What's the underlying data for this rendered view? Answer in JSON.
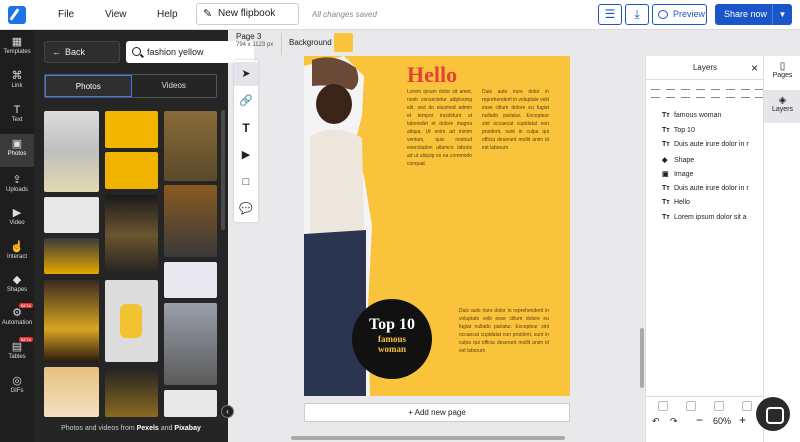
{
  "topbar": {
    "file": "File",
    "view": "View",
    "help": "Help",
    "new_flipbook": "New flipbook",
    "saved": "All changes saved",
    "preview": "Preview",
    "share": "Share now"
  },
  "left_nav": [
    {
      "label": "Templates",
      "icon": "templates-icon"
    },
    {
      "label": "Link",
      "icon": "link-icon"
    },
    {
      "label": "Text",
      "icon": "text-icon"
    },
    {
      "label": "Photos",
      "icon": "photos-icon"
    },
    {
      "label": "Uploads",
      "icon": "uploads-icon"
    },
    {
      "label": "Video",
      "icon": "video-icon"
    },
    {
      "label": "Interact",
      "icon": "interact-icon"
    },
    {
      "label": "Shapes",
      "icon": "shapes-icon"
    },
    {
      "label": "Automation",
      "icon": "automation-icon",
      "badge": "BETA"
    },
    {
      "label": "Tables",
      "icon": "tables-icon",
      "badge": "BETA"
    },
    {
      "label": "GIFs",
      "icon": "gifs-icon"
    }
  ],
  "side_panel": {
    "back": "Back",
    "search_value": "fashion yellow",
    "tab_photos": "Photos",
    "tab_videos": "Videos",
    "credit_prefix": "Photos and videos from",
    "credit_pexels": "Pexels",
    "credit_and": "and",
    "credit_pixabay": "Pixabay"
  },
  "canvas": {
    "page_label": "Page 3",
    "page_dims": "794 x 1123 px",
    "background_label": "Background",
    "background_color": "#f9c33c",
    "add_page": "+ Add new page"
  },
  "flipbook_page": {
    "title": "Hello",
    "col1": "Lorem ipsum dolor sit amet, nostr consectetur adipiscing elit, sed do eiusmod admin et tempor incididunt ut laboredet et dolore magna aliqua. Ut enim ad minim veniam, quis nostrud exercitation ullamco laboris ad ut aliquip ex ea commodo conquat.",
    "col2": "Duis aute irure dolor in reprehenderit in voluptate velit esse cillum dolore eu fugiat nullado pariatur. Excepteur sint occaecat cupidatat non proident, sunt in culpa qui officia deserunt mollit anim id est laborum",
    "col3": "Duis aute irure dolor in reprehenderit in voluptate velit esse cillum dolore eu fugiat nullado pariatur. Excepteur sint occaecat cupidatat non proident, sunt in culpa qui officia deserunt mollit anim id est laborum",
    "badge_line1": "Top 10",
    "badge_line2": "famous",
    "badge_line3": "woman"
  },
  "layers": {
    "title": "Layers",
    "items": [
      {
        "label": "famous woman",
        "type": "text"
      },
      {
        "label": "Top 10",
        "type": "text"
      },
      {
        "label": "Duis aute irure dolor in r",
        "type": "text"
      },
      {
        "label": "Shape",
        "type": "shape"
      },
      {
        "label": "Image",
        "type": "image"
      },
      {
        "label": "Duis aute irure dolor in r",
        "type": "text"
      },
      {
        "label": "Hello",
        "type": "text"
      },
      {
        "label": "Lorem ipsum dolor sit a",
        "type": "text"
      }
    ],
    "zoom": "60%"
  },
  "right_tabs": {
    "pages": "Pages",
    "layers": "Layers"
  },
  "colors": {
    "accent": "#1a56c8",
    "page_bg": "#f9c33c",
    "title_red": "#e6403a"
  }
}
